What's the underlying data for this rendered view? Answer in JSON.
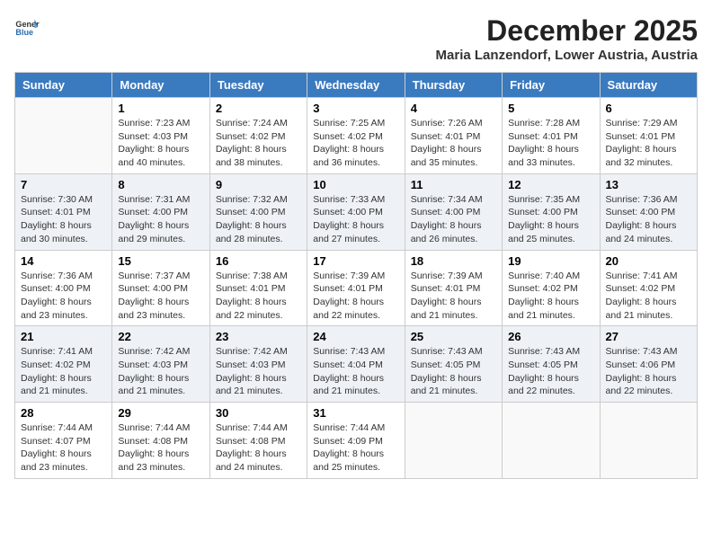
{
  "header": {
    "logo_general": "General",
    "logo_blue": "Blue",
    "main_title": "December 2025",
    "subtitle": "Maria Lanzendorf, Lower Austria, Austria"
  },
  "weekdays": [
    "Sunday",
    "Monday",
    "Tuesday",
    "Wednesday",
    "Thursday",
    "Friday",
    "Saturday"
  ],
  "weeks": [
    [
      {
        "day": "",
        "info": ""
      },
      {
        "day": "1",
        "info": "Sunrise: 7:23 AM\nSunset: 4:03 PM\nDaylight: 8 hours\nand 40 minutes."
      },
      {
        "day": "2",
        "info": "Sunrise: 7:24 AM\nSunset: 4:02 PM\nDaylight: 8 hours\nand 38 minutes."
      },
      {
        "day": "3",
        "info": "Sunrise: 7:25 AM\nSunset: 4:02 PM\nDaylight: 8 hours\nand 36 minutes."
      },
      {
        "day": "4",
        "info": "Sunrise: 7:26 AM\nSunset: 4:01 PM\nDaylight: 8 hours\nand 35 minutes."
      },
      {
        "day": "5",
        "info": "Sunrise: 7:28 AM\nSunset: 4:01 PM\nDaylight: 8 hours\nand 33 minutes."
      },
      {
        "day": "6",
        "info": "Sunrise: 7:29 AM\nSunset: 4:01 PM\nDaylight: 8 hours\nand 32 minutes."
      }
    ],
    [
      {
        "day": "7",
        "info": "Sunrise: 7:30 AM\nSunset: 4:01 PM\nDaylight: 8 hours\nand 30 minutes."
      },
      {
        "day": "8",
        "info": "Sunrise: 7:31 AM\nSunset: 4:00 PM\nDaylight: 8 hours\nand 29 minutes."
      },
      {
        "day": "9",
        "info": "Sunrise: 7:32 AM\nSunset: 4:00 PM\nDaylight: 8 hours\nand 28 minutes."
      },
      {
        "day": "10",
        "info": "Sunrise: 7:33 AM\nSunset: 4:00 PM\nDaylight: 8 hours\nand 27 minutes."
      },
      {
        "day": "11",
        "info": "Sunrise: 7:34 AM\nSunset: 4:00 PM\nDaylight: 8 hours\nand 26 minutes."
      },
      {
        "day": "12",
        "info": "Sunrise: 7:35 AM\nSunset: 4:00 PM\nDaylight: 8 hours\nand 25 minutes."
      },
      {
        "day": "13",
        "info": "Sunrise: 7:36 AM\nSunset: 4:00 PM\nDaylight: 8 hours\nand 24 minutes."
      }
    ],
    [
      {
        "day": "14",
        "info": "Sunrise: 7:36 AM\nSunset: 4:00 PM\nDaylight: 8 hours\nand 23 minutes."
      },
      {
        "day": "15",
        "info": "Sunrise: 7:37 AM\nSunset: 4:00 PM\nDaylight: 8 hours\nand 23 minutes."
      },
      {
        "day": "16",
        "info": "Sunrise: 7:38 AM\nSunset: 4:01 PM\nDaylight: 8 hours\nand 22 minutes."
      },
      {
        "day": "17",
        "info": "Sunrise: 7:39 AM\nSunset: 4:01 PM\nDaylight: 8 hours\nand 22 minutes."
      },
      {
        "day": "18",
        "info": "Sunrise: 7:39 AM\nSunset: 4:01 PM\nDaylight: 8 hours\nand 21 minutes."
      },
      {
        "day": "19",
        "info": "Sunrise: 7:40 AM\nSunset: 4:02 PM\nDaylight: 8 hours\nand 21 minutes."
      },
      {
        "day": "20",
        "info": "Sunrise: 7:41 AM\nSunset: 4:02 PM\nDaylight: 8 hours\nand 21 minutes."
      }
    ],
    [
      {
        "day": "21",
        "info": "Sunrise: 7:41 AM\nSunset: 4:02 PM\nDaylight: 8 hours\nand 21 minutes."
      },
      {
        "day": "22",
        "info": "Sunrise: 7:42 AM\nSunset: 4:03 PM\nDaylight: 8 hours\nand 21 minutes."
      },
      {
        "day": "23",
        "info": "Sunrise: 7:42 AM\nSunset: 4:03 PM\nDaylight: 8 hours\nand 21 minutes."
      },
      {
        "day": "24",
        "info": "Sunrise: 7:43 AM\nSunset: 4:04 PM\nDaylight: 8 hours\nand 21 minutes."
      },
      {
        "day": "25",
        "info": "Sunrise: 7:43 AM\nSunset: 4:05 PM\nDaylight: 8 hours\nand 21 minutes."
      },
      {
        "day": "26",
        "info": "Sunrise: 7:43 AM\nSunset: 4:05 PM\nDaylight: 8 hours\nand 22 minutes."
      },
      {
        "day": "27",
        "info": "Sunrise: 7:43 AM\nSunset: 4:06 PM\nDaylight: 8 hours\nand 22 minutes."
      }
    ],
    [
      {
        "day": "28",
        "info": "Sunrise: 7:44 AM\nSunset: 4:07 PM\nDaylight: 8 hours\nand 23 minutes."
      },
      {
        "day": "29",
        "info": "Sunrise: 7:44 AM\nSunset: 4:08 PM\nDaylight: 8 hours\nand 23 minutes."
      },
      {
        "day": "30",
        "info": "Sunrise: 7:44 AM\nSunset: 4:08 PM\nDaylight: 8 hours\nand 24 minutes."
      },
      {
        "day": "31",
        "info": "Sunrise: 7:44 AM\nSunset: 4:09 PM\nDaylight: 8 hours\nand 25 minutes."
      },
      {
        "day": "",
        "info": ""
      },
      {
        "day": "",
        "info": ""
      },
      {
        "day": "",
        "info": ""
      }
    ]
  ]
}
